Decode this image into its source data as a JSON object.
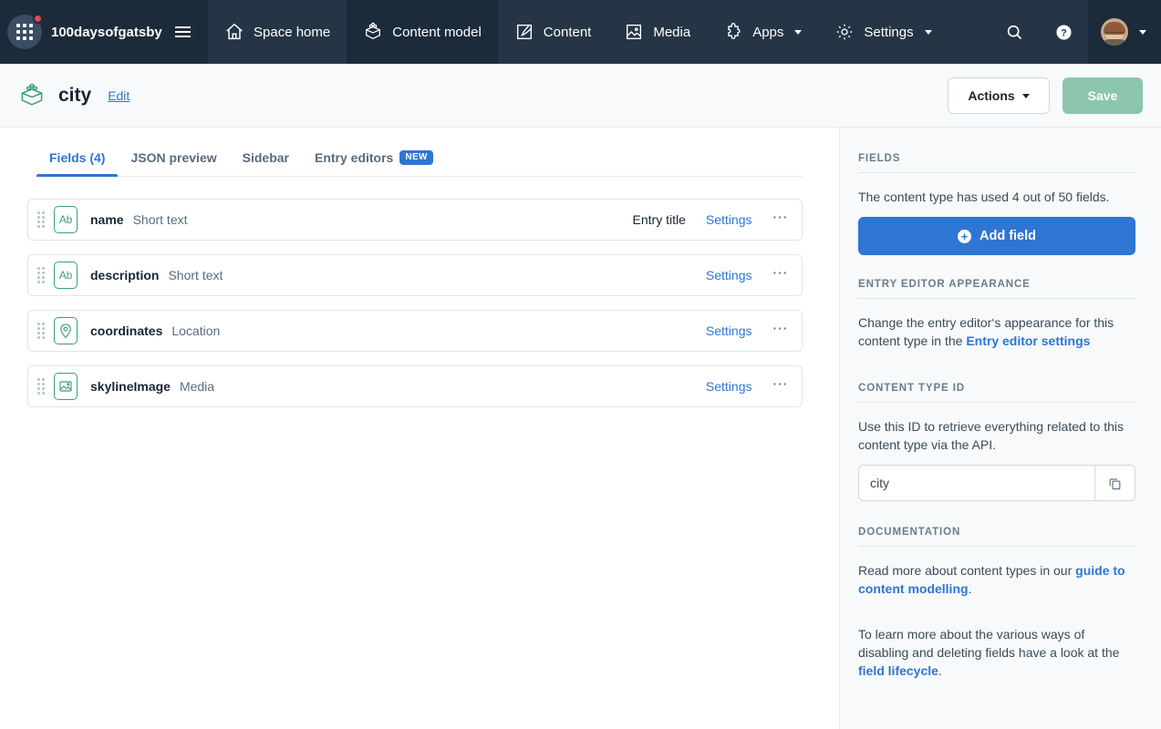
{
  "colors": {
    "nav_bg": "#253545",
    "nav_bg_active": "#1c2b3a",
    "accent_blue": "#2e75d4",
    "accent_green": "#3c9f76",
    "save_disabled_green": "#8cc6ad",
    "notification_red": "#e5484d",
    "sidebar_bg": "#f7f9fa",
    "text_dark": "#192532",
    "text_muted": "#5a6b7b"
  },
  "topnav": {
    "launcher_icon": "apps-grid-icon",
    "has_notification_dot": true,
    "space_name": "100daysofgatsby",
    "menu_icon": "hamburger-menu-icon",
    "items": [
      {
        "label": "Space home",
        "icon": "home-icon",
        "active": false,
        "has_caret": false
      },
      {
        "label": "Content model",
        "icon": "content-model-icon",
        "active": true,
        "has_caret": false
      },
      {
        "label": "Content",
        "icon": "content-pencil-icon",
        "active": false,
        "has_caret": false
      },
      {
        "label": "Media",
        "icon": "media-image-icon",
        "active": false,
        "has_caret": false
      },
      {
        "label": "Apps",
        "icon": "apps-puzzle-icon",
        "active": false,
        "has_caret": true
      },
      {
        "label": "Settings",
        "icon": "gear-icon",
        "active": false,
        "has_caret": true
      }
    ],
    "search_icon": "search-icon",
    "help_icon": "help-circle-icon",
    "avatar": "user-avatar",
    "avatar_caret": "chevron-down-icon"
  },
  "subheader": {
    "content_type_icon": "content-type-block-icon",
    "title": "city",
    "edit_label": "Edit",
    "actions_label": "Actions",
    "save_label": "Save",
    "save_disabled": true
  },
  "tabs": [
    {
      "label": "Fields (4)",
      "active": true,
      "badge": null
    },
    {
      "label": "JSON preview",
      "active": false,
      "badge": null
    },
    {
      "label": "Sidebar",
      "active": false,
      "badge": null
    },
    {
      "label": "Entry editors",
      "active": false,
      "badge": "NEW"
    }
  ],
  "fields": {
    "settings_label": "Settings",
    "more_label": "⋯",
    "entry_title_label": "Entry title",
    "rows": [
      {
        "name": "name",
        "type": "Short text",
        "icon": "short-text-ab-icon",
        "is_entry_title": true
      },
      {
        "name": "description",
        "type": "Short text",
        "icon": "short-text-ab-icon",
        "is_entry_title": false
      },
      {
        "name": "coordinates",
        "type": "Location",
        "icon": "location-pin-icon",
        "is_entry_title": false
      },
      {
        "name": "skylineImage",
        "type": "Media",
        "icon": "media-image-icon",
        "is_entry_title": false
      }
    ]
  },
  "sidebar": {
    "fields_section": {
      "heading": "FIELDS",
      "usage_text": "The content type has used 4 out of 50 fields.",
      "add_field_label": "Add field",
      "add_field_icon": "plus-circle-icon"
    },
    "appearance_section": {
      "heading": "ENTRY EDITOR APPEARANCE",
      "text_before": "Change the entry editor‘s appearance for this content type in the ",
      "link_label": "Entry editor settings"
    },
    "content_type_id_section": {
      "heading": "CONTENT TYPE ID",
      "description": "Use this ID to retrieve everything related to this content type via the API.",
      "value": "city",
      "placeholder": "Content type ID",
      "copy_icon": "copy-icon"
    },
    "documentation_section": {
      "heading": "DOCUMENTATION",
      "para1_before": "Read more about content types in our ",
      "para1_link": "guide to content modelling",
      "para1_after": ".",
      "para2_before": "To learn more about the various ways of disabling and deleting fields have a look at the ",
      "para2_link": "field lifecycle",
      "para2_after": "."
    }
  }
}
